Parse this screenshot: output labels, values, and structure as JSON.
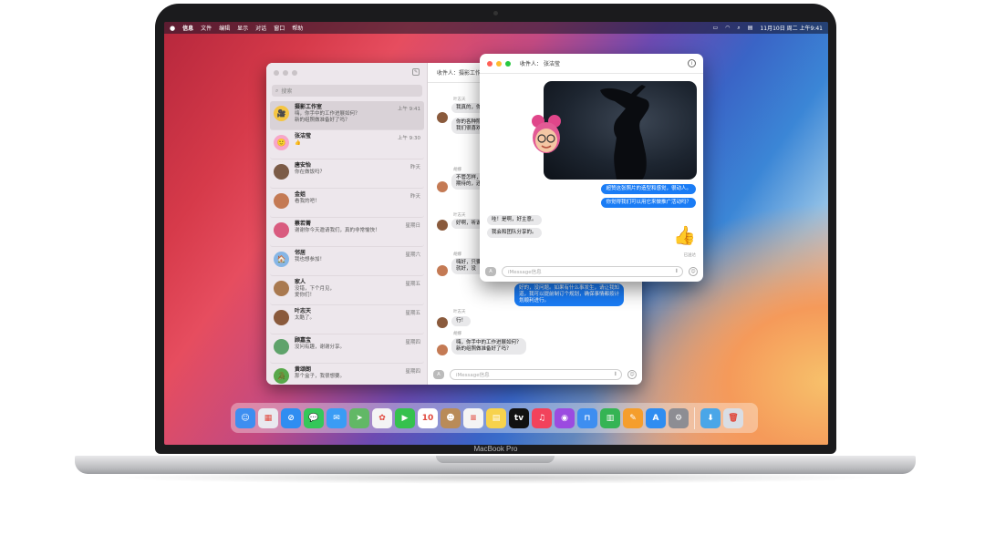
{
  "laptop": {
    "brand": "MacBook Pro"
  },
  "menubar": {
    "app": "信息",
    "items": [
      "文件",
      "编辑",
      "显示",
      "对话",
      "窗口",
      "帮助"
    ],
    "clock": "11月10日 周二 上午9:41"
  },
  "sidebar": {
    "search_placeholder": "搜索",
    "conversations": [
      {
        "name": "摄影工作室",
        "preview": "嗨，你手中的工作进展如何？\n新的组照做准备好了吗？",
        "time": "上午 9:41",
        "color": "#f5c542",
        "icon": "🎥"
      },
      {
        "name": "张洁莹",
        "preview": "👍",
        "time": "上午 9:30",
        "color": "#f7a7c9",
        "icon": "🙂"
      },
      {
        "name": "唐安怡",
        "preview": "你在做饭吗？",
        "time": "昨天",
        "color": "#7b5b47",
        "icon": ""
      },
      {
        "name": "金姐",
        "preview": "看我的吧！",
        "time": "昨天",
        "color": "#c47a54",
        "icon": ""
      },
      {
        "name": "蔡若菁",
        "preview": "谢谢你今天邀请我们，真的非常愉快！",
        "time": "星期日",
        "color": "#d95b7f",
        "icon": ""
      },
      {
        "name": "邻居",
        "preview": "我也想参加！",
        "time": "星期六",
        "color": "#86b6e6",
        "icon": "🏠"
      },
      {
        "name": "家人",
        "preview": "没错，下个月见，\n爱你们！",
        "time": "星期五",
        "color": "#a9794f",
        "icon": ""
      },
      {
        "name": "叶志天",
        "preview": "太酷了。",
        "time": "星期五",
        "color": "#8a5a3c",
        "icon": ""
      },
      {
        "name": "顾嘉宝",
        "preview": "没问有趣，谢谢分享。",
        "time": "星期四",
        "color": "#5fa36b",
        "icon": ""
      },
      {
        "name": "黄颂朗",
        "preview": "那个盒子，我很想要。",
        "time": "星期四",
        "color": "#58a84a",
        "icon": "🐊"
      }
    ]
  },
  "chat": {
    "to_label": "收件人：",
    "to_name": "摄影工作室",
    "input_placeholder": "iMessage信息",
    "senders": [
      "叶志天",
      "胡娜",
      "叶志天",
      "胡娜",
      "叶志天",
      "胡娜"
    ],
    "messages": [
      {
        "text": "我真的，你",
        "dir": "in"
      },
      {
        "text": "你的各种照片\n我们很喜欢",
        "dir": "in"
      },
      {
        "text": "不管怎样，你\n期待的，还",
        "dir": "in"
      },
      {
        "text": "好啊，听说",
        "dir": "in"
      },
      {
        "text": "嗨好，只要\n就好，没",
        "dir": "in"
      },
      {
        "text": "好的，没问题。如果有什么事发生，请让我知\n道，我可以提前制订个规划，确保事情都按计\n划顺利进行。",
        "dir": "out"
      },
      {
        "text": "行！",
        "dir": "in"
      },
      {
        "text": "嗨，你手中的工作进展如何？\n新的组照做准备好了吗？",
        "dir": "in"
      }
    ]
  },
  "popup": {
    "to_label": "收件人：",
    "to_name": "张洁莹",
    "messages_out": [
      "超赞这张照片的造型和感觉，很动人。",
      "你觉得我们可以用它来做推广活动吗？"
    ],
    "messages_in": [
      "哇！是啊，好主意。",
      "我会和团队分享的。"
    ],
    "thumb": "👍",
    "delivered": "已送达",
    "input_placeholder": "iMessage信息"
  },
  "dock": [
    {
      "name": "finder-icon",
      "color": "#3d8ef0",
      "glyph": "☺"
    },
    {
      "name": "launchpad-icon",
      "color": "#e9e9ef",
      "glyph": "▦"
    },
    {
      "name": "safari-icon",
      "color": "#2f8df1",
      "glyph": "⊘"
    },
    {
      "name": "messages-icon",
      "color": "#34c759",
      "glyph": "💬"
    },
    {
      "name": "mail-icon",
      "color": "#3a9cf5",
      "glyph": "✉"
    },
    {
      "name": "maps-icon",
      "color": "#62b866",
      "glyph": "➤"
    },
    {
      "name": "photos-icon",
      "color": "#f4f4f4",
      "glyph": "✿"
    },
    {
      "name": "facetime-icon",
      "color": "#35c14e",
      "glyph": "▶"
    },
    {
      "name": "calendar-icon",
      "color": "#ffffff",
      "glyph": "10"
    },
    {
      "name": "contacts-icon",
      "color": "#b98b58",
      "glyph": "☻"
    },
    {
      "name": "reminders-icon",
      "color": "#f4f4f4",
      "glyph": "≡"
    },
    {
      "name": "notes-icon",
      "color": "#f7d24c",
      "glyph": "▤"
    },
    {
      "name": "tv-icon",
      "color": "#111111",
      "glyph": "tv"
    },
    {
      "name": "music-icon",
      "color": "#f2425b",
      "glyph": "♫"
    },
    {
      "name": "podcasts-icon",
      "color": "#9b4be0",
      "glyph": "◉"
    },
    {
      "name": "keynote-icon",
      "color": "#3d8ef0",
      "glyph": "⊓"
    },
    {
      "name": "numbers-icon",
      "color": "#35b454",
      "glyph": "▥"
    },
    {
      "name": "pages-icon",
      "color": "#f59e2c",
      "glyph": "✎"
    },
    {
      "name": "app-store-icon",
      "color": "#2f8df1",
      "glyph": "A"
    },
    {
      "name": "system-preferences-icon",
      "color": "#8d8d93",
      "glyph": "⚙"
    },
    {
      "name": "downloads-folder-icon",
      "color": "#4aa6e8",
      "glyph": "⬇"
    },
    {
      "name": "trash-icon",
      "color": "#d9dde4",
      "glyph": "🗑"
    }
  ]
}
